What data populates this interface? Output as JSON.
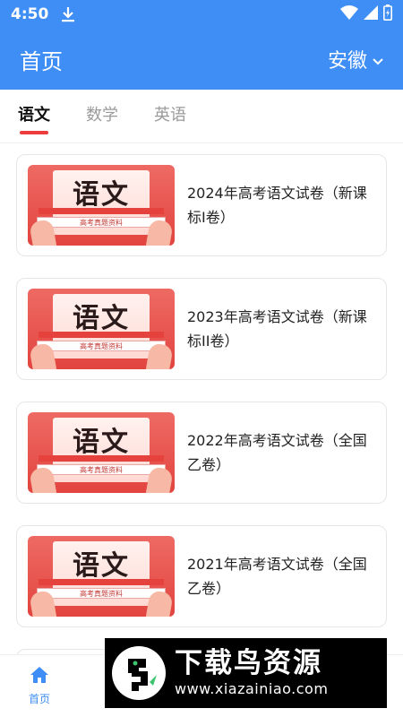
{
  "status_bar": {
    "time": "4:50"
  },
  "app_bar": {
    "title": "首页",
    "region": "安徽"
  },
  "tabs": [
    {
      "label": "语文",
      "active": true
    },
    {
      "label": "数学",
      "active": false
    },
    {
      "label": "英语",
      "active": false
    }
  ],
  "thumbnail": {
    "title": "语文",
    "subtitle": "高考真题资料"
  },
  "exams": [
    {
      "title": "2024年高考语文试卷（新课标I卷）"
    },
    {
      "title": "2023年高考语文试卷（新课标II卷）"
    },
    {
      "title": "2022年高考语文试卷（全国乙卷）"
    },
    {
      "title": "2021年高考语文试卷（全国乙卷）"
    }
  ],
  "bottom_nav": [
    {
      "label": "首页",
      "icon": "home-icon",
      "active": true
    }
  ],
  "watermark": {
    "name": "下载鸟资源",
    "url": "www.xiazainiao.com"
  },
  "colors": {
    "primary": "#3f8ef5",
    "accent_red": "#ee3b3b",
    "card_border": "#e6e6e6"
  }
}
